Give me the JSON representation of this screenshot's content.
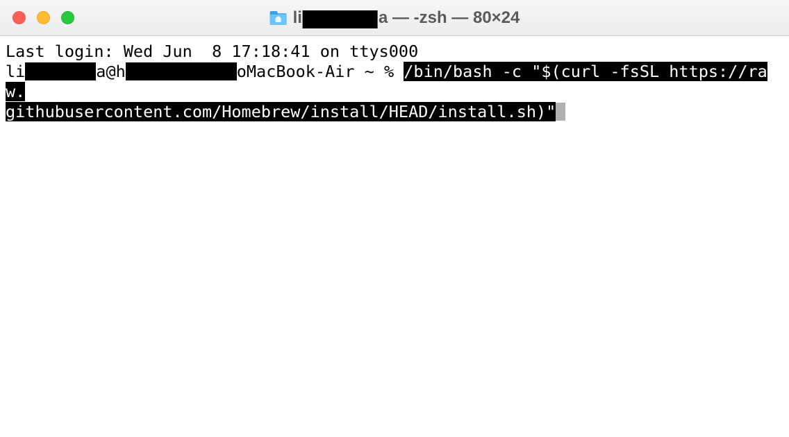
{
  "window": {
    "title_prefix": "li",
    "title_suffix": "a — -zsh — 80×24"
  },
  "terminal": {
    "last_login": "Last login: Wed Jun  8 17:18:41 on ttys000",
    "prompt": {
      "p1": "li",
      "p2": "a@h",
      "p3": "oMacBook-Air ~ % "
    },
    "command_line1": "/bin/bash -c \"$(curl -fsSL https://raw.",
    "command_line2": "githubusercontent.com/Homebrew/install/HEAD/install.sh)\""
  }
}
